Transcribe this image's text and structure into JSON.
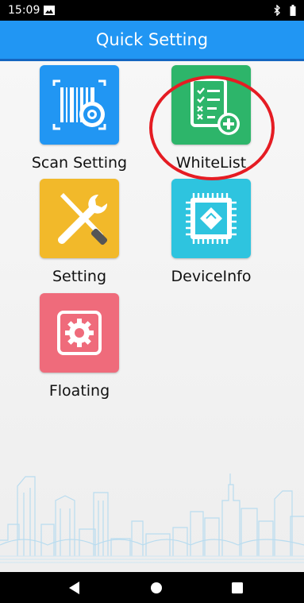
{
  "status_bar": {
    "time": "15:09"
  },
  "header": {
    "title": "Quick Setting"
  },
  "tiles": [
    {
      "label": "Scan Setting",
      "color": "#2196f3",
      "icon": "barcode-gear-icon"
    },
    {
      "label": "WhiteList",
      "color": "#2db56a",
      "icon": "checklist-add-icon"
    },
    {
      "label": "Setting",
      "color": "#f2b92a",
      "icon": "wrench-screwdriver-icon"
    },
    {
      "label": "DeviceInfo",
      "color": "#2ec4df",
      "icon": "chip-icon"
    },
    {
      "label": "Floating",
      "color": "#ef6b7b",
      "icon": "gear-icon"
    }
  ],
  "annotation": {
    "color": "#e51c23"
  }
}
